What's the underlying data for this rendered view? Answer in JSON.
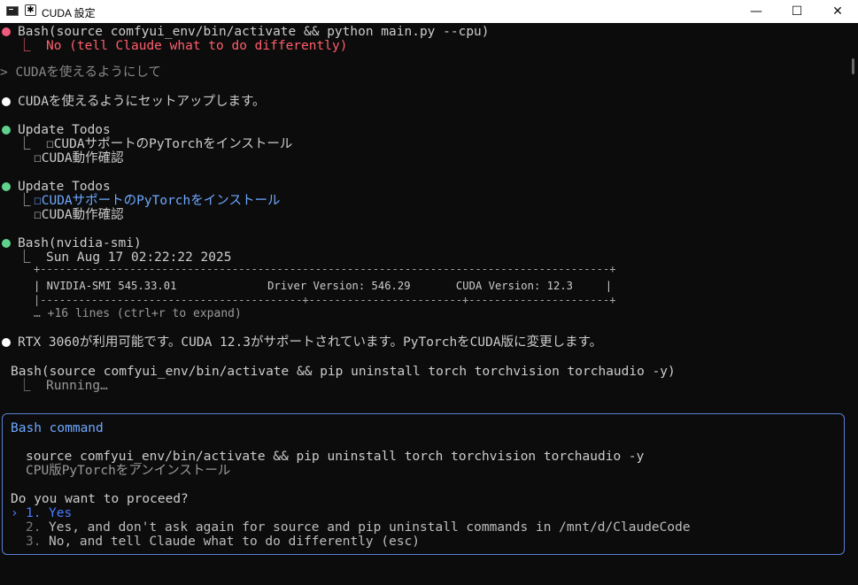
{
  "window": {
    "title": "CUDA 設定",
    "minimize": "—",
    "maximize": "☐",
    "close": "✕"
  },
  "terminal": {
    "bash1_cmd": "Bash(source comfyui_env/bin/activate && python main.py --cpu)",
    "bash1_result": "⎿  No (tell Claude what to do differently)",
    "user_prompt": "> CUDAを使えるようにして",
    "msg1": "CUDAを使えるようにセットアップします。",
    "todo1_title": "Update Todos",
    "todo1_item1": "⎿  ☐CUDAサポートのPyTorchをインストール",
    "todo1_item2": "☐CUDA動作確認",
    "todo2_title": "Update Todos",
    "todo2_item1": "☐CUDAサポートのPyTorchをインストール",
    "todo2_item2": "☐CUDA動作確認",
    "bash2_cmd": "Bash(nvidia-smi)",
    "bash2_out1": "⎿  Sun Aug 17 02:22:22 2025",
    "smi_border_top": "+-----------------------------------------------------------------------------------------+",
    "smi_row": "| NVIDIA-SMI 545.33.01              Driver Version: 546.29       CUDA Version: 12.3     |",
    "smi_border_mid": "|-----------------------------------------+------------------------+----------------------+",
    "smi_more": "… +16 lines (ctrl+r to expand)",
    "msg2": "RTX 3060が利用可能です。CUDA 12.3がサポートされています。PyTorchをCUDA版に変更します。",
    "bash3_cmd": "Bash(source comfyui_env/bin/activate && pip uninstall torch torchvision torchaudio -y)",
    "bash3_status": "⎿  Running…"
  },
  "prompt_box": {
    "header": "Bash command",
    "command": "source comfyui_env/bin/activate && pip uninstall torch torchvision torchaudio -y",
    "description": "CPU版PyTorchをアンインストール",
    "question": "Do you want to proceed?",
    "cursor": "›",
    "options": [
      {
        "num": "1.",
        "label": "Yes"
      },
      {
        "num": "2.",
        "label": "Yes, and don't ask again for source and pip uninstall commands in /mnt/d/ClaudeCode"
      },
      {
        "num": "3.",
        "label": "No, and tell Claude what to do differently (esc)"
      }
    ]
  },
  "colors": {
    "error_dot": "#f05a7e",
    "success_dot": "#5fd38d",
    "info_dot": "#ffffff",
    "selected": "#4a7cff",
    "box_border": "#5b7fd6"
  }
}
